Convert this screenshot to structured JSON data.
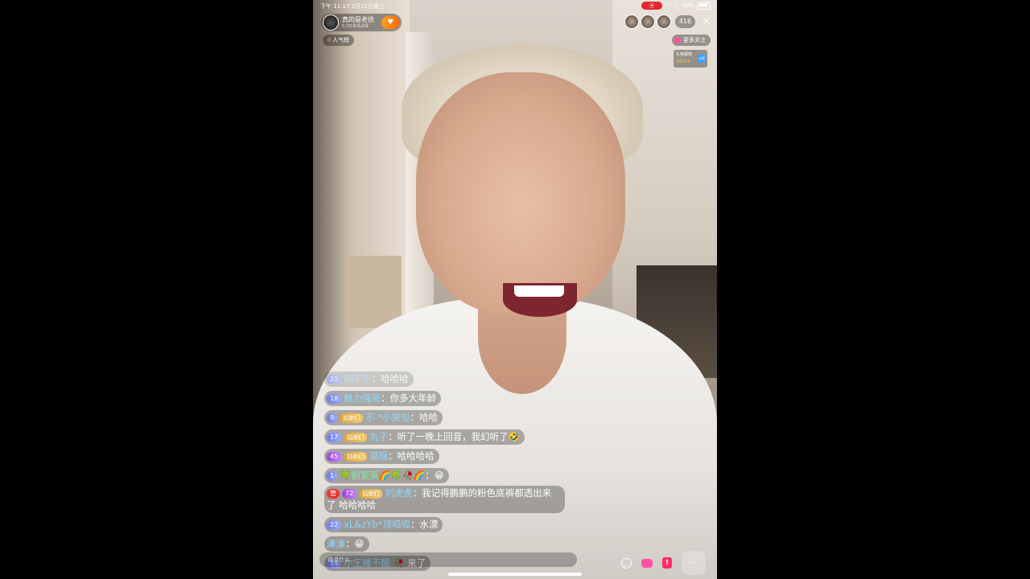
{
  "status_bar": {
    "time_date": "下午 11:17   2月21日周三",
    "battery": "93%"
  },
  "host": {
    "name": "真的是老徐",
    "sub": "5.3万本场点赞",
    "follow_icon": "heart-icon"
  },
  "rank_chip": {
    "icon": "bar-chart-icon",
    "label": "人气榜"
  },
  "viewers": {
    "count": "416",
    "close": "×"
  },
  "more_follow": {
    "label": "更多关注"
  },
  "gift_progress": {
    "title": "礼物展馆",
    "progress": "16/24",
    "tag": "点亮"
  },
  "chat": [
    {
      "level": "21",
      "fan": "",
      "user": "胡平平",
      "text": "：哈哈哈",
      "faded": true
    },
    {
      "level": "18",
      "fan": "",
      "user": "魅力强哥",
      "text": "：你多大年龄"
    },
    {
      "level": "9",
      "fan": "姑娘们",
      "user": "不 *小哭包",
      "text": "：哈哈"
    },
    {
      "level": "17",
      "fan": "姑娘们",
      "user": "丸子",
      "text": "：听了一晚上回音，我幻听了🤣"
    },
    {
      "level": "45",
      "fan": "姑娘们",
      "user": "璐瑶",
      "text": "：哈哈哈哈",
      "purple": true
    },
    {
      "level": "1",
      "fan": "",
      "user": "🍀劉繁英🌈🍀🥀🌈",
      "text": "：😁",
      "green": true
    },
    {
      "level": "72",
      "fan": "姑娘们",
      "user": "刘虎虎",
      "text": "：我记得鹏鹏的粉色底裤都透出来了 哈哈哈哈",
      "purple": true,
      "badge": "管"
    },
    {
      "level": "22",
      "fan": "",
      "user": "xL&zYb*顶呱呱",
      "text": "：水漂"
    },
    {
      "level": "",
      "fan": "",
      "user": "溱溱",
      "text": "：😁"
    },
    {
      "level": "14",
      "fan": "",
      "user": "小王睡不醒",
      "text": " 🥀 来了"
    }
  ],
  "input": {
    "placeholder": "说点什么..."
  },
  "bottom_icons": [
    "smile-icon",
    "gift-icon",
    "alert-icon",
    "more-icon"
  ]
}
